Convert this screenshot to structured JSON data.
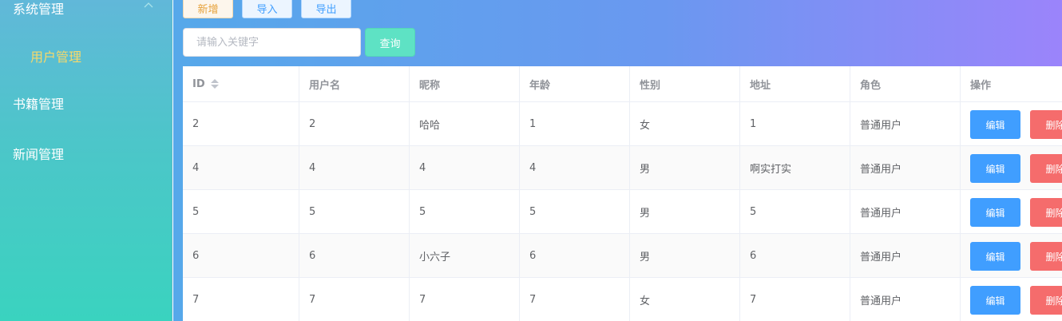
{
  "sidebar": {
    "items": [
      {
        "label": "系统管理"
      },
      {
        "label": "用户管理"
      },
      {
        "label": "书籍管理"
      },
      {
        "label": "新闻管理"
      }
    ]
  },
  "toolbar": {
    "add_label": "新增",
    "import_label": "导入",
    "export_label": "导出"
  },
  "search": {
    "placeholder": "请输入关键字",
    "value": "",
    "query_label": "查询"
  },
  "table": {
    "columns": [
      "ID",
      "用户名",
      "昵称",
      "年龄",
      "性别",
      "地址",
      "角色",
      "操作"
    ],
    "edit_label": "编辑",
    "delete_label": "删除",
    "rows": [
      {
        "id": "2",
        "username": "2",
        "nickname": "哈哈",
        "age": "1",
        "sex": "女",
        "address": "1",
        "role": "普通用户"
      },
      {
        "id": "4",
        "username": "4",
        "nickname": "4",
        "age": "4",
        "sex": "男",
        "address": "啊实打实",
        "role": "普通用户"
      },
      {
        "id": "5",
        "username": "5",
        "nickname": "5",
        "age": "5",
        "sex": "男",
        "address": "5",
        "role": "普通用户"
      },
      {
        "id": "6",
        "username": "6",
        "nickname": "小六子",
        "age": "6",
        "sex": "男",
        "address": "6",
        "role": "普通用户"
      },
      {
        "id": "7",
        "username": "7",
        "nickname": "7",
        "age": "7",
        "sex": "女",
        "address": "7",
        "role": "普通用户"
      }
    ]
  },
  "colors": {
    "primary": "#409eff",
    "danger": "#f56c6c",
    "warning": "#e6a23c",
    "success": "#5ee2c4",
    "active_menu": "#f7d96a"
  },
  "icons": {
    "sort": "sort-caret-icon",
    "submenu_toggle": "chevron-up-icon"
  }
}
